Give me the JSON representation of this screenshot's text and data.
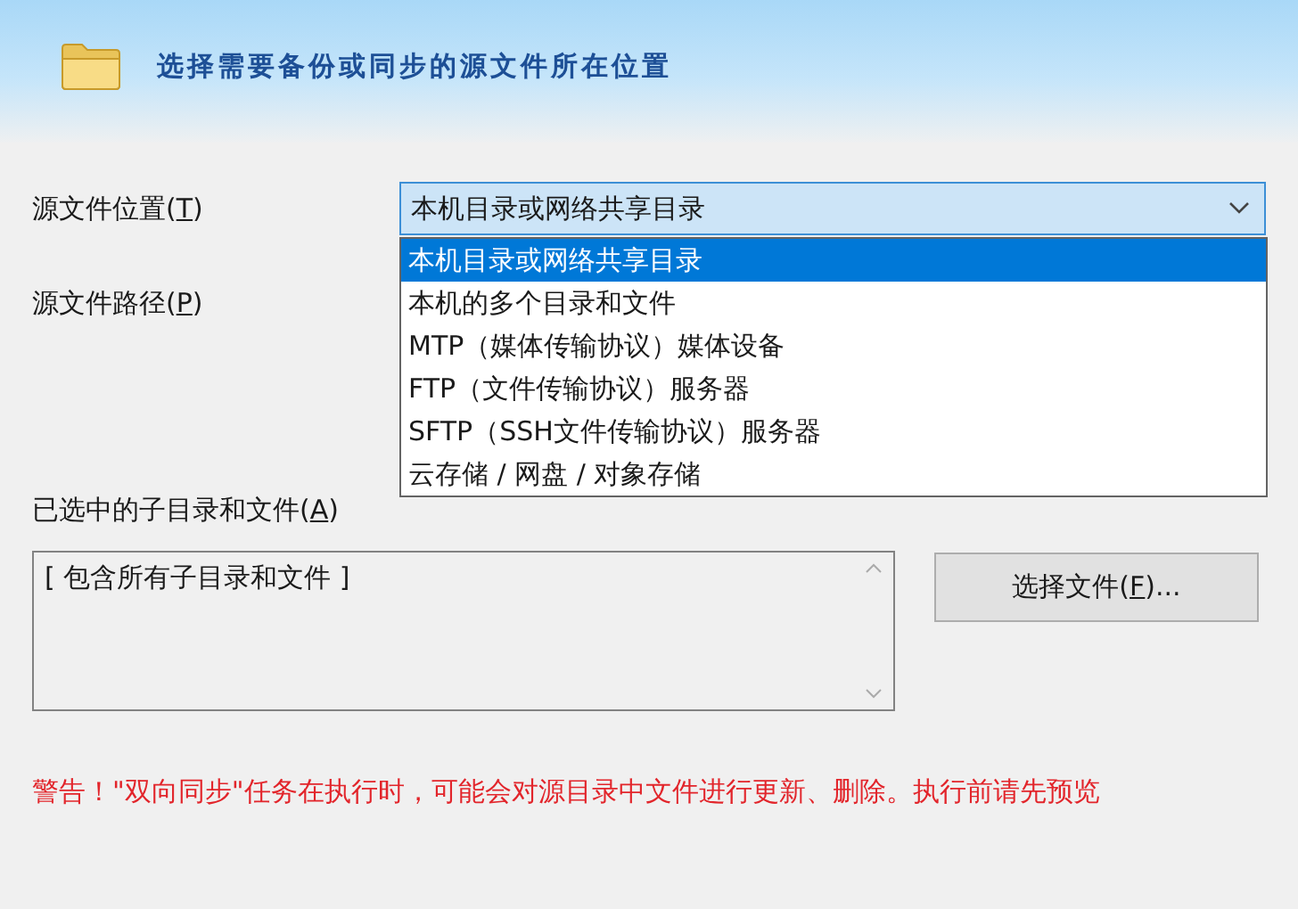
{
  "header": {
    "title": "选择需要备份或同步的源文件所在位置"
  },
  "fields": [
    {
      "kind": "combo",
      "label": {
        "before": "源文件位置(",
        "key": "T",
        "after": ")"
      },
      "value": "本机目录或网络共享目录",
      "expanded": true,
      "options": [
        {
          "text": "本机目录或网络共享目录",
          "selected": true
        },
        {
          "text": "本机的多个目录和文件",
          "selected": false
        },
        {
          "text": "MTP（媒体传输协议）媒体设备",
          "selected": false
        },
        {
          "text": "FTP（文件传输协议）服务器",
          "selected": false
        },
        {
          "text": "SFTP（SSH文件传输协议）服务器",
          "selected": false
        },
        {
          "text": "云存储 / 网盘 / 对象存储",
          "selected": false
        }
      ]
    },
    {
      "kind": "path",
      "label": {
        "before": "源文件路径(",
        "key": "P",
        "after": ")"
      }
    }
  ],
  "selection": {
    "label": {
      "before": "已选中的子目录和文件(",
      "key": "A",
      "after": ")"
    },
    "items": [
      "[ 包含所有子目录和文件 ]"
    ],
    "button": {
      "before": "选择文件(",
      "key": "F",
      "after": ")..."
    }
  },
  "warning": "警告！\"双向同步\"任务在执行时，可能会对源目录中文件进行更新、删除。执行前请先预览"
}
